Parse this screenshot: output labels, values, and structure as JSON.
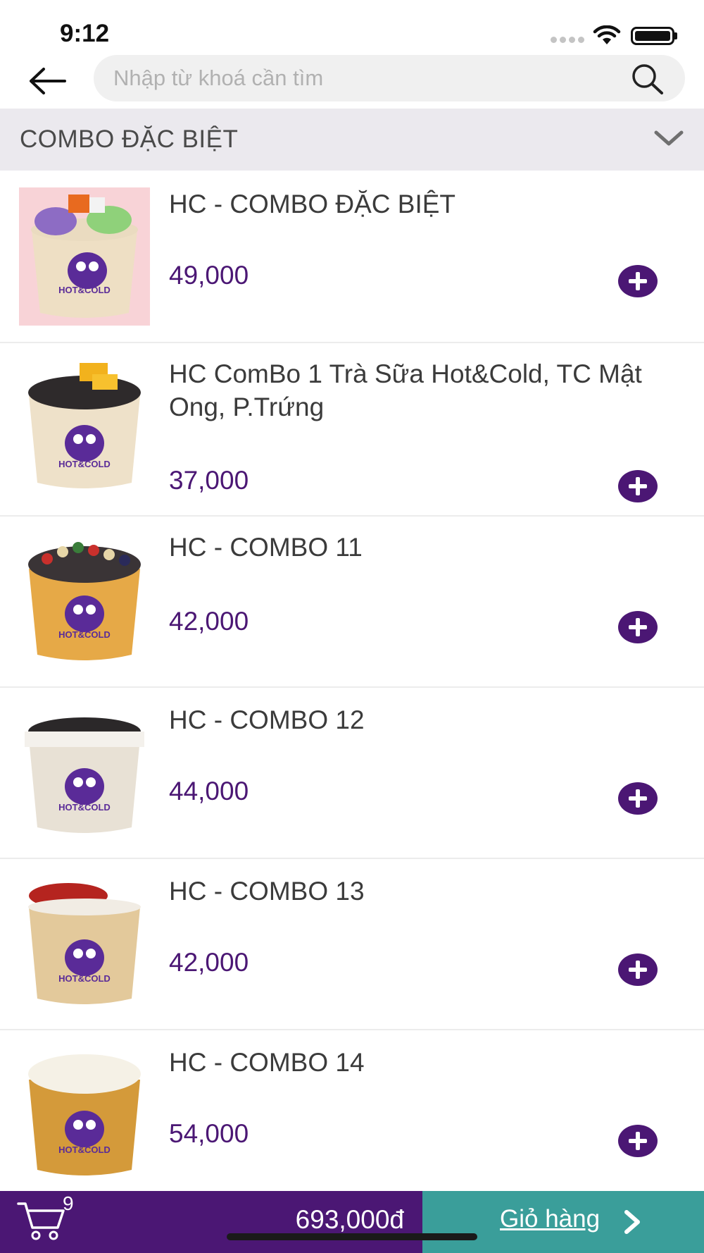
{
  "status_bar": {
    "time": "9:12"
  },
  "search": {
    "placeholder": "Nhập từ khoá cần tìm"
  },
  "category": {
    "title": "COMBO ĐẶC BIỆT"
  },
  "products": [
    {
      "name": "HC - COMBO ĐẶC BIỆT",
      "price": "49,000"
    },
    {
      "name": "HC ComBo 1 Trà Sữa Hot&Cold, TC Mật Ong, P.Trứng",
      "price": "37,000"
    },
    {
      "name": "HC - COMBO 11",
      "price": "42,000"
    },
    {
      "name": "HC - COMBO 12",
      "price": "44,000"
    },
    {
      "name": "HC - COMBO 13",
      "price": "42,000"
    },
    {
      "name": "HC - COMBO 14",
      "price": "54,000"
    }
  ],
  "cart": {
    "count": "9",
    "total": "693,000đ",
    "button_label": "Giỏ hàng"
  },
  "colors": {
    "brand_purple": "#4b1774",
    "cart_teal": "#3a9e9a",
    "category_bg": "#ebe9ee"
  },
  "icons": [
    "back-arrow-icon",
    "search-icon",
    "chevron-down-icon",
    "plus-icon",
    "cart-icon",
    "chevron-right-icon"
  ]
}
